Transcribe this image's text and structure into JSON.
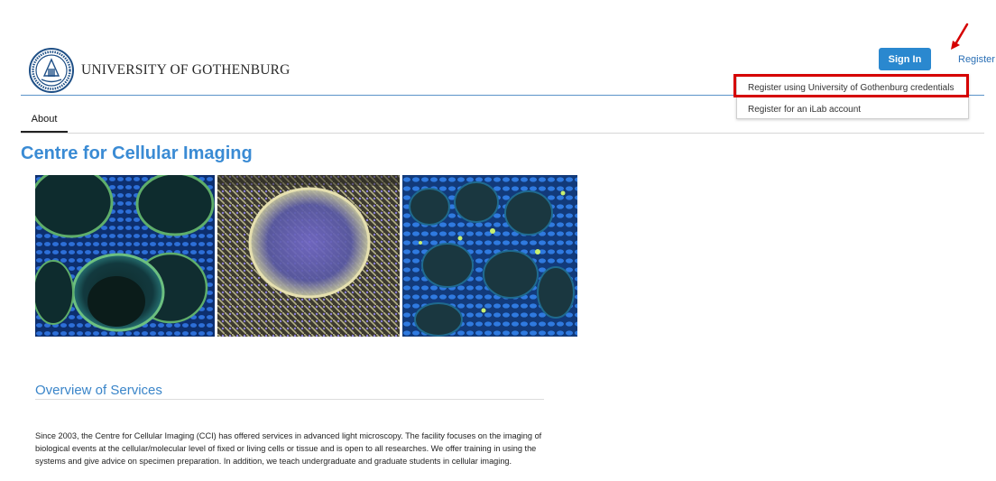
{
  "header": {
    "university_name": "UNIVERSITY OF GOTHENBURG",
    "sign_in_label": "Sign In",
    "register_label": "Register"
  },
  "register_menu": {
    "items": [
      {
        "label": "Register using University of Gothenburg credentials"
      },
      {
        "label": "Register for an iLab account"
      }
    ]
  },
  "tabs": [
    {
      "label": "About",
      "active": true
    }
  ],
  "page": {
    "title": "Centre for Cellular Imaging"
  },
  "overview": {
    "heading": "Overview of Services",
    "text": "Since 2003, the Centre for Cellular Imaging (CCI) has offered services in advanced light microscopy. The facility focuses on the imaging of biological events at the cellular/molecular level of fixed or living cells or tissue and is open to all researches. We offer training in using the systems and give advice on specimen preparation. In addition, we teach undergraduate and graduate students in cellular imaging."
  },
  "colors": {
    "accent": "#3a8bd4",
    "button": "#2a88cf",
    "highlight": "#d50000"
  }
}
